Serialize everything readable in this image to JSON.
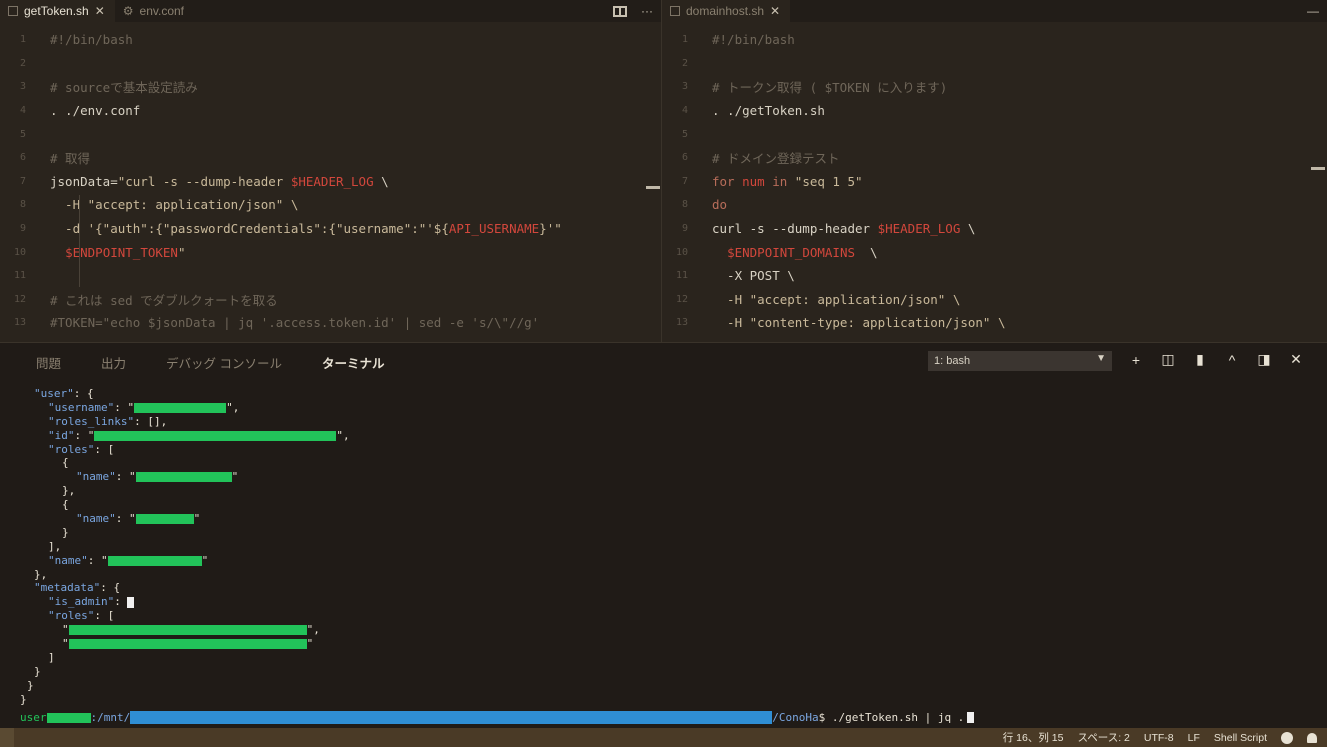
{
  "editor_left": {
    "tabs": [
      {
        "label": "getToken.sh",
        "close": "✕"
      },
      {
        "label": "env.conf"
      }
    ],
    "lines": [
      {
        "n": "1",
        "segments": [
          {
            "t": "#!/bin/bash",
            "c": "comment"
          }
        ]
      },
      {
        "n": "2",
        "segments": []
      },
      {
        "n": "3",
        "segments": [
          {
            "t": "# sourceで基本設定読み",
            "c": "comment"
          }
        ]
      },
      {
        "n": "4",
        "segments": [
          {
            "t": ". ./env.conf",
            "c": "lt"
          }
        ]
      },
      {
        "n": "5",
        "segments": []
      },
      {
        "n": "6",
        "segments": [
          {
            "t": "# 取得",
            "c": "comment"
          }
        ]
      },
      {
        "n": "7",
        "segments": [
          {
            "t": "jsonData=",
            "c": "lt"
          },
          {
            "t": "\"curl -s --dump-header ",
            "c": "str"
          },
          {
            "t": "$HEADER_LOG",
            "c": "var"
          },
          {
            "t": " \\",
            "c": "lt"
          }
        ]
      },
      {
        "n": "8",
        "segments": [
          {
            "t": "  -H \"accept: application/json\" \\",
            "c": "str"
          }
        ]
      },
      {
        "n": "9",
        "segments": [
          {
            "t": "  -d '{\"auth\":{\"passwordCredentials\":{\"username\":\"'${",
            "c": "str"
          },
          {
            "t": "API_USERNAME",
            "c": "var"
          },
          {
            "t": "}'\"",
            "c": "str"
          }
        ]
      },
      {
        "n": "10",
        "segments": [
          {
            "t": "  ",
            "c": "lt"
          },
          {
            "t": "$ENDPOINT_TOKEN",
            "c": "var"
          },
          {
            "t": "\"",
            "c": "str"
          }
        ]
      },
      {
        "n": "11",
        "segments": []
      },
      {
        "n": "12",
        "segments": [
          {
            "t": "# これは sed でダブルクォートを取る",
            "c": "comment"
          }
        ]
      },
      {
        "n": "13",
        "segments": [
          {
            "t": "#TOKEN=\"echo $jsonData | jq '.access.token.id' | sed -e 's/\\\"//g'",
            "c": "comment"
          }
        ]
      }
    ]
  },
  "editor_right": {
    "tabs": [
      {
        "label": "domainhost.sh",
        "close": "✕"
      }
    ],
    "lines": [
      {
        "n": "1",
        "segments": [
          {
            "t": "#!/bin/bash",
            "c": "comment"
          }
        ]
      },
      {
        "n": "2",
        "segments": []
      },
      {
        "n": "3",
        "segments": [
          {
            "t": "# トークン取得 ( $TOKEN に入ります)",
            "c": "comment"
          }
        ]
      },
      {
        "n": "4",
        "segments": [
          {
            "t": ". ./getToken.sh",
            "c": "lt"
          }
        ]
      },
      {
        "n": "5",
        "segments": []
      },
      {
        "n": "6",
        "segments": [
          {
            "t": "# ドメイン登録テスト",
            "c": "comment"
          }
        ]
      },
      {
        "n": "7",
        "segments": [
          {
            "t": "for ",
            "c": "kw"
          },
          {
            "t": "num",
            "c": "var"
          },
          {
            "t": " in ",
            "c": "kw"
          },
          {
            "t": "\"seq 1 5\"",
            "c": "str"
          }
        ]
      },
      {
        "n": "8",
        "segments": [
          {
            "t": "do",
            "c": "kw"
          }
        ]
      },
      {
        "n": "9",
        "segments": [
          {
            "t": "curl -s --dump-header ",
            "c": "lt"
          },
          {
            "t": "$HEADER_LOG",
            "c": "var"
          },
          {
            "t": " \\",
            "c": "lt"
          }
        ]
      },
      {
        "n": "10",
        "segments": [
          {
            "t": "  ",
            "c": "lt"
          },
          {
            "t": "$ENDPOINT_DOMAINS",
            "c": "var"
          },
          {
            "t": "  \\",
            "c": "lt"
          }
        ]
      },
      {
        "n": "11",
        "segments": [
          {
            "t": "  -X POST \\",
            "c": "lt"
          }
        ]
      },
      {
        "n": "12",
        "segments": [
          {
            "t": "  -H \"accept: application/json\" \\",
            "c": "str"
          }
        ]
      },
      {
        "n": "13",
        "segments": [
          {
            "t": "  -H \"content-type: application/json\" \\",
            "c": "str"
          }
        ]
      }
    ]
  },
  "panel": {
    "tabs": [
      "問題",
      "出力",
      "デバッグ コンソール",
      "ターミナル"
    ],
    "active_tab": 3,
    "terminal_select": "1: bash",
    "terminal_lines": [
      {
        "i": 2,
        "parts": [
          {
            "t": "\"user\"",
            "c": "jk"
          },
          {
            "t": ": {",
            "c": "jp"
          }
        ]
      },
      {
        "i": 4,
        "parts": [
          {
            "t": "\"username\"",
            "c": "jk"
          },
          {
            "t": ": \"",
            "c": "jp"
          },
          {
            "redact": 92
          },
          {
            "t": "\",",
            "c": "jp"
          }
        ]
      },
      {
        "i": 4,
        "parts": [
          {
            "t": "\"roles_links\"",
            "c": "jk"
          },
          {
            "t": ": [],",
            "c": "jp"
          }
        ]
      },
      {
        "i": 4,
        "parts": [
          {
            "t": "\"id\"",
            "c": "jk"
          },
          {
            "t": ": \"",
            "c": "jp"
          },
          {
            "redact": 242
          },
          {
            "t": "\",",
            "c": "jp"
          }
        ]
      },
      {
        "i": 4,
        "parts": [
          {
            "t": "\"roles\"",
            "c": "jk"
          },
          {
            "t": ": [",
            "c": "jp"
          }
        ]
      },
      {
        "i": 6,
        "parts": [
          {
            "t": "{",
            "c": "jp"
          }
        ]
      },
      {
        "i": 8,
        "parts": [
          {
            "t": "\"name\"",
            "c": "jk"
          },
          {
            "t": ": \"",
            "c": "jp"
          },
          {
            "redact": 96
          },
          {
            "t": "\"",
            "c": "jp"
          }
        ]
      },
      {
        "i": 6,
        "parts": [
          {
            "t": "},",
            "c": "jp"
          }
        ]
      },
      {
        "i": 6,
        "parts": [
          {
            "t": "{",
            "c": "jp"
          }
        ]
      },
      {
        "i": 8,
        "parts": [
          {
            "t": "\"name\"",
            "c": "jk"
          },
          {
            "t": ": \"",
            "c": "jp"
          },
          {
            "redact": 58
          },
          {
            "t": "\"",
            "c": "jp"
          }
        ]
      },
      {
        "i": 6,
        "parts": [
          {
            "t": "}",
            "c": "jp"
          }
        ]
      },
      {
        "i": 4,
        "parts": [
          {
            "t": "],",
            "c": "jp"
          }
        ]
      },
      {
        "i": 4,
        "parts": [
          {
            "t": "\"name\"",
            "c": "jk"
          },
          {
            "t": ": \"",
            "c": "jp"
          },
          {
            "redact": 94
          },
          {
            "t": "\"",
            "c": "jp"
          }
        ]
      },
      {
        "i": 2,
        "parts": [
          {
            "t": "},",
            "c": "jp"
          }
        ]
      },
      {
        "i": 2,
        "parts": [
          {
            "t": "\"metadata\"",
            "c": "jk"
          },
          {
            "t": ": {",
            "c": "jp"
          }
        ]
      },
      {
        "i": 4,
        "parts": [
          {
            "t": "\"is_admin\"",
            "c": "jk"
          },
          {
            "t": ": ",
            "c": "jp"
          },
          {
            "cursor": true
          }
        ]
      },
      {
        "i": 4,
        "parts": [
          {
            "t": "\"roles\"",
            "c": "jk"
          },
          {
            "t": ": [",
            "c": "jp"
          }
        ]
      },
      {
        "i": 6,
        "parts": [
          {
            "t": "\"",
            "c": "jp"
          },
          {
            "redact": 238
          },
          {
            "t": "\",",
            "c": "jp"
          }
        ]
      },
      {
        "i": 6,
        "parts": [
          {
            "t": "\"",
            "c": "jp"
          },
          {
            "redact": 238
          },
          {
            "t": "\"",
            "c": "jp"
          }
        ]
      },
      {
        "i": 4,
        "parts": [
          {
            "t": "]",
            "c": "jp"
          }
        ]
      },
      {
        "i": 2,
        "parts": [
          {
            "t": "}",
            "c": "jp"
          }
        ]
      },
      {
        "i": 1,
        "parts": [
          {
            "t": "}",
            "c": "jp"
          }
        ]
      },
      {
        "i": 0,
        "parts": [
          {
            "t": "}",
            "c": "jp"
          }
        ]
      }
    ],
    "prompt": {
      "user": "user",
      "host_sep": ":/mnt/",
      "dir": "/ConoHa",
      "command": "$ ./getToken.sh | jq ."
    }
  },
  "statusbar": {
    "position": "行 16、列 15",
    "spaces": "スペース: 2",
    "encoding": "UTF-8",
    "eol": "LF",
    "language": "Shell Script"
  }
}
